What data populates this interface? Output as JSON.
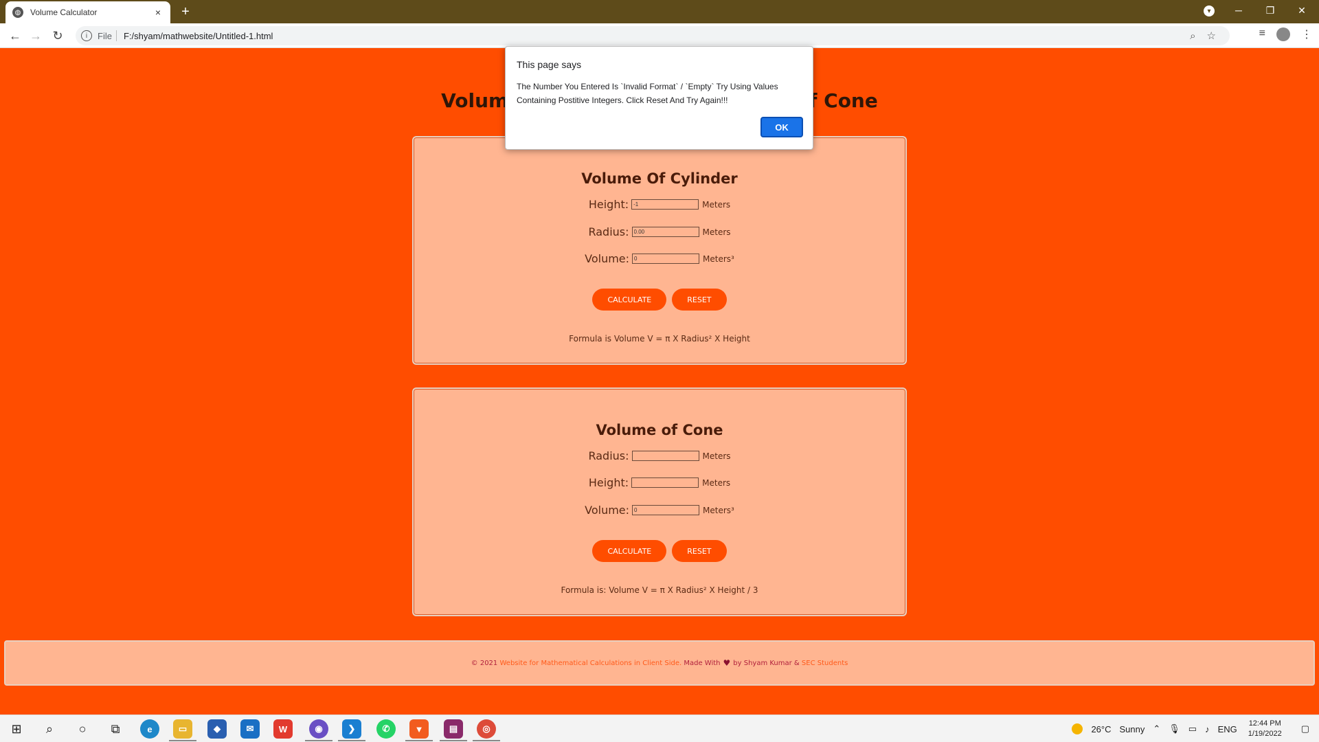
{
  "browser": {
    "tab_title": "Volume Calculator",
    "tab_close": "×",
    "new_tab": "+",
    "url_scheme": "File",
    "url": "F:/shyam/mathwebsite/Untitled-1.html"
  },
  "page": {
    "title": "Volume Of Cylinder And Volume Of Cone"
  },
  "cylinder": {
    "title": "Volume Of Cylinder",
    "height_label": "Height:",
    "height_value": "-1",
    "radius_label": "Radius:",
    "radius_value": "0.00",
    "volume_label": "Volume:",
    "volume_value": "0",
    "unit": "Meters",
    "volume_unit": "Meters³",
    "calculate_label": "CALCULATE",
    "reset_label": "RESET",
    "formula": "Formula is Volume V = π X Radius² X Height"
  },
  "cone": {
    "title": "Volume of Cone",
    "radius_label": "Radius:",
    "radius_value": "",
    "height_label": "Height:",
    "height_value": "",
    "volume_label": "Volume:",
    "volume_value": "0",
    "unit": "Meters",
    "volume_unit": "Meters³",
    "calculate_label": "CALCULATE",
    "reset_label": "RESET",
    "formula": "Formula is: Volume V = π X Radius² X Height / 3"
  },
  "footer": {
    "copyright": "© 2021",
    "site_link": "Website for Mathematical Calculations in Client Side.",
    "made_with": "Made With",
    "heart": "♥",
    "by": "by Shyam Kumar &",
    "students_link": "SEC Students"
  },
  "dialog": {
    "title": "This page says",
    "message": "The Number You Entered Is `Invalid Format` / `Empty` Try Using Values Containing Postitive Integers. Click Reset And Try Again!!!",
    "ok_label": "OK"
  },
  "taskbar": {
    "temperature": "26°C",
    "weather": "Sunny",
    "language": "ENG",
    "time": "12:44 PM",
    "date": "1/19/2022"
  },
  "colors": {
    "page_bg": "#ff4d00",
    "card_bg": "#ffb591",
    "button_bg": "#ff4d00",
    "dialog_ok": "#1a73e8",
    "tabbar_bg": "#5e4b1a"
  }
}
